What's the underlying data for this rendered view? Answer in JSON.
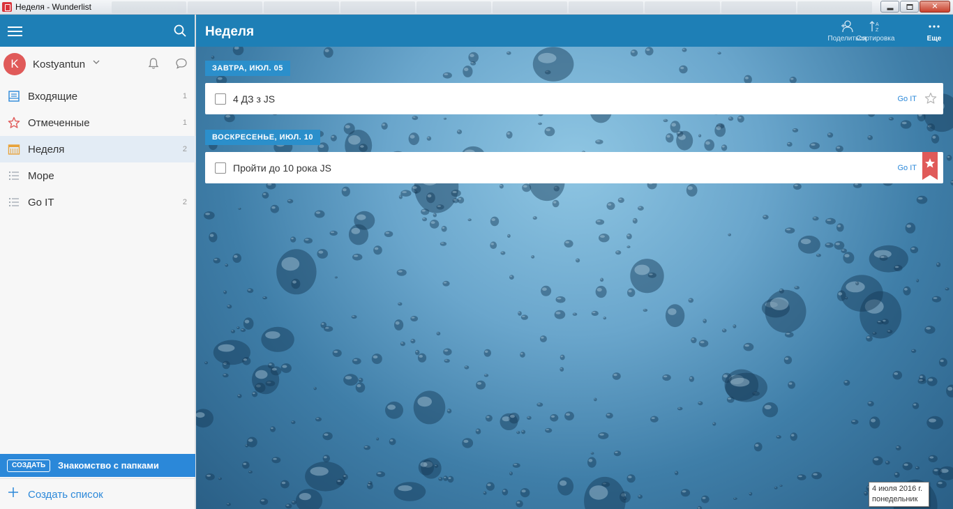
{
  "window": {
    "title": "Неделя - Wunderlist"
  },
  "user": {
    "initial": "K",
    "name": "Kostyantun"
  },
  "sidebar": {
    "items": [
      {
        "label": "Входящие",
        "count": "1",
        "icon": "inbox-icon",
        "color": "#2b88d9"
      },
      {
        "label": "Отмеченные",
        "count": "1",
        "icon": "star-icon",
        "color": "#e05a59"
      },
      {
        "label": "Неделя",
        "count": "2",
        "icon": "calendar-icon",
        "color": "#e8a33a"
      },
      {
        "label": "Море",
        "count": "",
        "icon": "list-icon",
        "color": "#9aa3ad"
      },
      {
        "label": "Go IT",
        "count": "2",
        "icon": "list-icon",
        "color": "#9aa3ad"
      }
    ],
    "promo": {
      "badge": "СОЗДАТЬ",
      "text": "Знакомство с папками"
    },
    "create_list": "Создать список"
  },
  "header": {
    "title": "Неделя",
    "share": "Поделиться",
    "sort": "Сортировка",
    "more": "Еще"
  },
  "groups": [
    {
      "date": "ЗАВТРА, ИЮЛ. 05",
      "tasks": [
        {
          "title": "4 ДЗ з JS",
          "list": "Go IT",
          "starred": false
        }
      ]
    },
    {
      "date": "ВОСКРЕСЕНЬЕ, ИЮЛ. 10",
      "tasks": [
        {
          "title": "Пройти до 10 рока JS",
          "list": "Go IT",
          "starred": true
        }
      ]
    }
  ],
  "tooltip": {
    "line1": "4 июля 2016 г.",
    "line2": "понедельник"
  },
  "colors": {
    "accent": "#1e7fb6",
    "brand_blue": "#2b88d9",
    "star_red": "#e05a59"
  }
}
